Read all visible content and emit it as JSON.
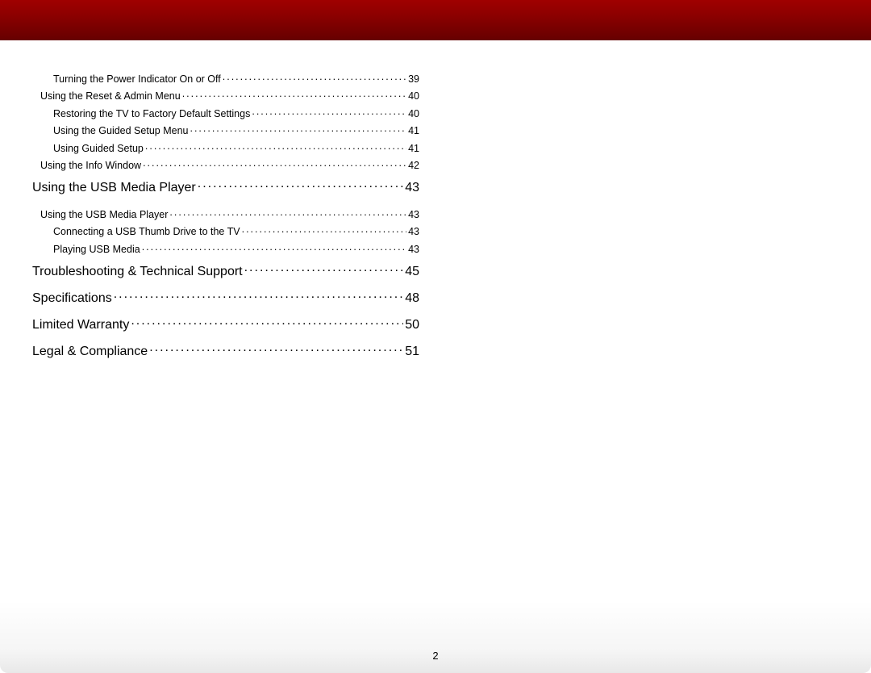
{
  "page_number": "2",
  "toc": [
    {
      "level": 3,
      "label": "Turning the Power Indicator On or Off",
      "page": "39"
    },
    {
      "level": 2,
      "label": "Using the Reset & Admin Menu",
      "page": "40"
    },
    {
      "level": 3,
      "label": "Restoring the TV to Factory Default Settings",
      "page": "40"
    },
    {
      "level": 3,
      "label": "Using the Guided Setup Menu",
      "page": "41"
    },
    {
      "level": 3,
      "label": "Using Guided Setup",
      "page": "41"
    },
    {
      "level": 2,
      "label": "Using the Info Window",
      "page": "42"
    },
    {
      "level": 1,
      "label": "Using the USB Media Player",
      "page": "43"
    },
    {
      "level": 2,
      "label": "Using the USB Media Player",
      "page": "43"
    },
    {
      "level": 3,
      "label": "Connecting a USB Thumb Drive to the TV",
      "page": "43"
    },
    {
      "level": 3,
      "label": "Playing USB Media",
      "page": "43"
    },
    {
      "level": 1,
      "label": "Troubleshooting & Technical Support",
      "page": "45"
    },
    {
      "level": 1,
      "label": "Specifications",
      "page": "48"
    },
    {
      "level": 1,
      "label": "Limited Warranty",
      "page": "50"
    },
    {
      "level": 1,
      "label": "Legal & Compliance",
      "page": "51"
    }
  ]
}
